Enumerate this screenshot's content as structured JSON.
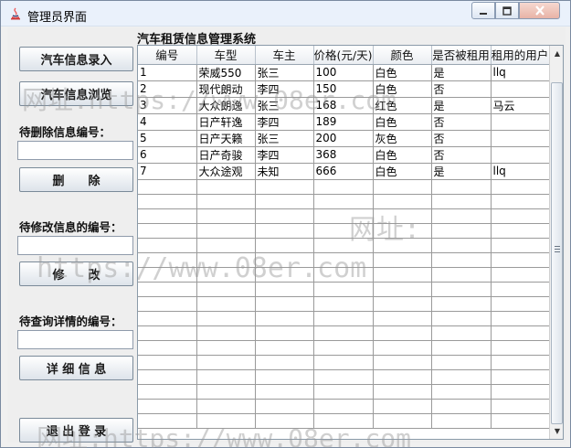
{
  "window": {
    "title": "管理员界面",
    "minimize_icon": "minimize-icon",
    "maximize_icon": "maximize-icon",
    "close_icon": "close-icon"
  },
  "left_panel": {
    "add_button": "汽车信息录入",
    "browse_button": "汽车信息浏览",
    "delete_label": "待删除信息编号：",
    "delete_input_value": "",
    "delete_button": "删　　除",
    "modify_label": "待修改信息的编号：",
    "modify_input_value": "",
    "modify_button": "修　　改",
    "query_label": "待查询详情的编号：",
    "query_input_value": "",
    "detail_button": "详 细 信 息",
    "logout_button": "退 出 登 录"
  },
  "table": {
    "title": "汽车租赁信息管理系统",
    "columns": [
      "编号",
      "车型",
      "车主",
      "价格(元/天)",
      "颜色",
      "是否被租用",
      "租用的用户"
    ],
    "rows": [
      [
        "1",
        "荣威550",
        "张三",
        "100",
        "白色",
        "是",
        "llq"
      ],
      [
        "2",
        "现代朗动",
        "李四",
        "150",
        "白色",
        "否",
        ""
      ],
      [
        "3",
        "大众朗逸",
        "张三",
        "168",
        "红色",
        "是",
        "马云"
      ],
      [
        "4",
        "日产轩逸",
        "李四",
        "189",
        "白色",
        "否",
        ""
      ],
      [
        "5",
        "日产天籁",
        "张三",
        "200",
        "灰色",
        "否",
        ""
      ],
      [
        "6",
        "日产奇骏",
        "李四",
        "368",
        "白色",
        "否",
        ""
      ],
      [
        "7",
        "大众途观",
        "未知",
        "666",
        "白色",
        "是",
        "llq"
      ]
    ],
    "empty_row_count": 17
  },
  "watermarks": {
    "line1": "网址:https://www.08er.com",
    "line2": "网址:",
    "line3": "https://www.08er.com",
    "line4": "网址:https://www.08er.com"
  },
  "colors": {
    "titlebar": "#eaf1fb",
    "close_button": "#e8b3a6",
    "panel": "#eeeeee"
  }
}
